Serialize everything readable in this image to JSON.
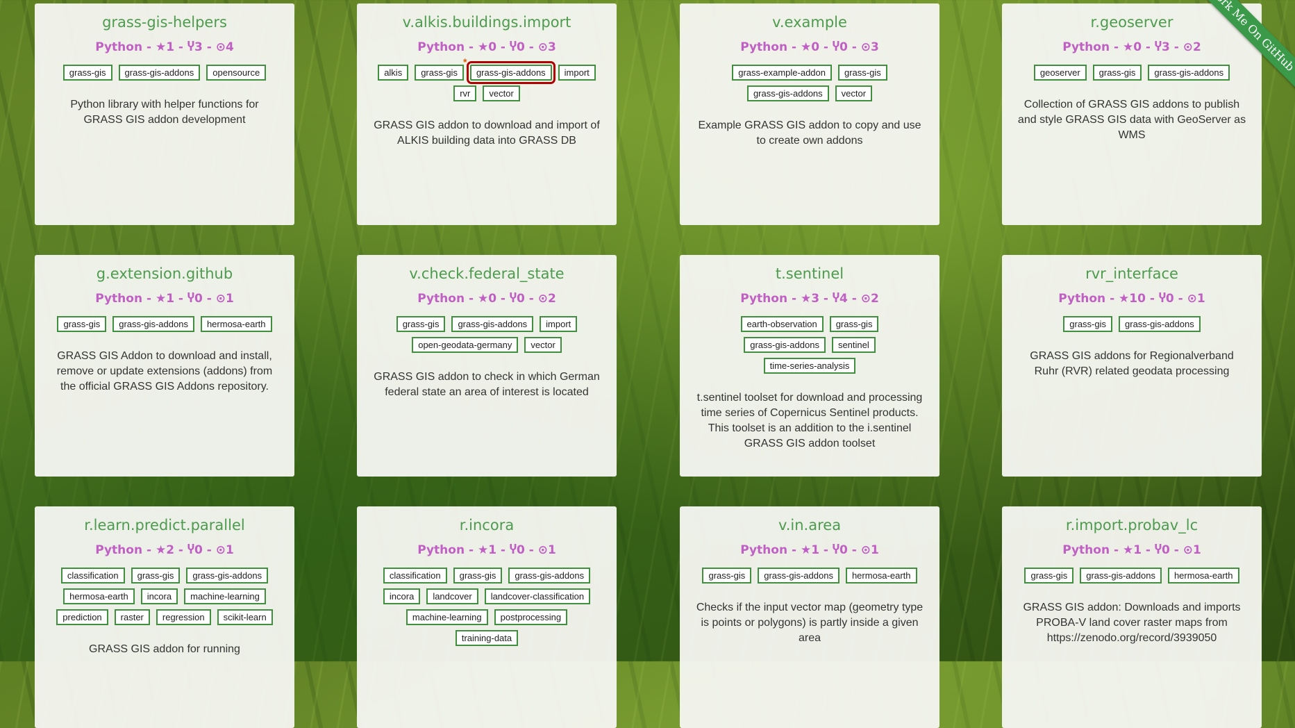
{
  "ribbon": "Fork Me On GitHub",
  "cards": [
    {
      "title": "grass-gis-helpers",
      "meta": "Python - ★1 - Ⴤ3 - ⊙4",
      "tags": [
        "grass-gis",
        "grass-gis-addons",
        "opensource"
      ],
      "desc": "Python library with helper functions for GRASS GIS addon development"
    },
    {
      "title": "v.alkis.buildings.import",
      "meta": "Python - ★0 - Ⴤ0 - ⊙3",
      "tags": [
        "alkis",
        "grass-gis",
        "grass-gis-addons",
        "import",
        "rvr",
        "vector"
      ],
      "selected_tag": "grass-gis-addons",
      "desc": "GRASS GIS addon to download and import of ALKIS building data into GRASS DB"
    },
    {
      "title": "v.example",
      "meta": "Python - ★0 - Ⴤ0 - ⊙3",
      "tags": [
        "grass-example-addon",
        "grass-gis",
        "grass-gis-addons",
        "vector"
      ],
      "desc": "Example GRASS GIS addon to copy and use to create own addons"
    },
    {
      "title": "r.geoserver",
      "meta": "Python - ★0 - Ⴤ3 - ⊙2",
      "tags": [
        "geoserver",
        "grass-gis",
        "grass-gis-addons"
      ],
      "desc": "Collection of GRASS GIS addons to publish and style GRASS GIS data with GeoServer as WMS"
    },
    {
      "title": "g.extension.github",
      "meta": "Python - ★1 - Ⴤ0 - ⊙1",
      "tags": [
        "grass-gis",
        "grass-gis-addons",
        "hermosa-earth"
      ],
      "desc": "GRASS GIS Addon to download and install, remove or update extensions (addons) from the official GRASS GIS Addons repository."
    },
    {
      "title": "v.check.federal_state",
      "meta": "Python - ★0 - Ⴤ0 - ⊙2",
      "tags": [
        "grass-gis",
        "grass-gis-addons",
        "import",
        "open-geodata-germany",
        "vector"
      ],
      "desc": "GRASS GIS addon to check in which German federal state an area of interest is located"
    },
    {
      "title": "t.sentinel",
      "meta": "Python - ★3 - Ⴤ4 - ⊙2",
      "tags": [
        "earth-observation",
        "grass-gis",
        "grass-gis-addons",
        "sentinel",
        "time-series-analysis"
      ],
      "desc": "t.sentinel toolset for download and processing time series of Copernicus Sentinel products. This toolset is an addition to the i.sentinel GRASS GIS addon toolset"
    },
    {
      "title": "rvr_interface",
      "meta": "Python - ★10 - Ⴤ0 - ⊙1",
      "tags": [
        "grass-gis",
        "grass-gis-addons"
      ],
      "desc": "GRASS GIS addons for Regionalverband Ruhr (RVR) related geodata processing"
    },
    {
      "title": "r.learn.predict.parallel",
      "meta": "Python - ★2 - Ⴤ0 - ⊙1",
      "tags": [
        "classification",
        "grass-gis",
        "grass-gis-addons",
        "hermosa-earth",
        "incora",
        "machine-learning",
        "prediction",
        "raster",
        "regression",
        "scikit-learn"
      ],
      "desc": "GRASS GIS addon for running"
    },
    {
      "title": "r.incora",
      "meta": "Python - ★1 - Ⴤ0 - ⊙1",
      "tags": [
        "classification",
        "grass-gis",
        "grass-gis-addons",
        "incora",
        "landcover",
        "landcover-classification",
        "machine-learning",
        "postprocessing",
        "training-data"
      ],
      "desc": ""
    },
    {
      "title": "v.in.area",
      "meta": "Python - ★1 - Ⴤ0 - ⊙1",
      "tags": [
        "grass-gis",
        "grass-gis-addons",
        "hermosa-earth"
      ],
      "desc": "Checks if the input vector map (geometry type is points or polygons) is partly inside a given area"
    },
    {
      "title": "r.import.probav_lc",
      "meta": "Python - ★1 - Ⴤ0 - ⊙1",
      "tags": [
        "grass-gis",
        "grass-gis-addons",
        "hermosa-earth"
      ],
      "desc": "GRASS GIS addon: Downloads and imports PROBA-V land cover raster maps from https://zenodo.org/record/3939050"
    }
  ]
}
